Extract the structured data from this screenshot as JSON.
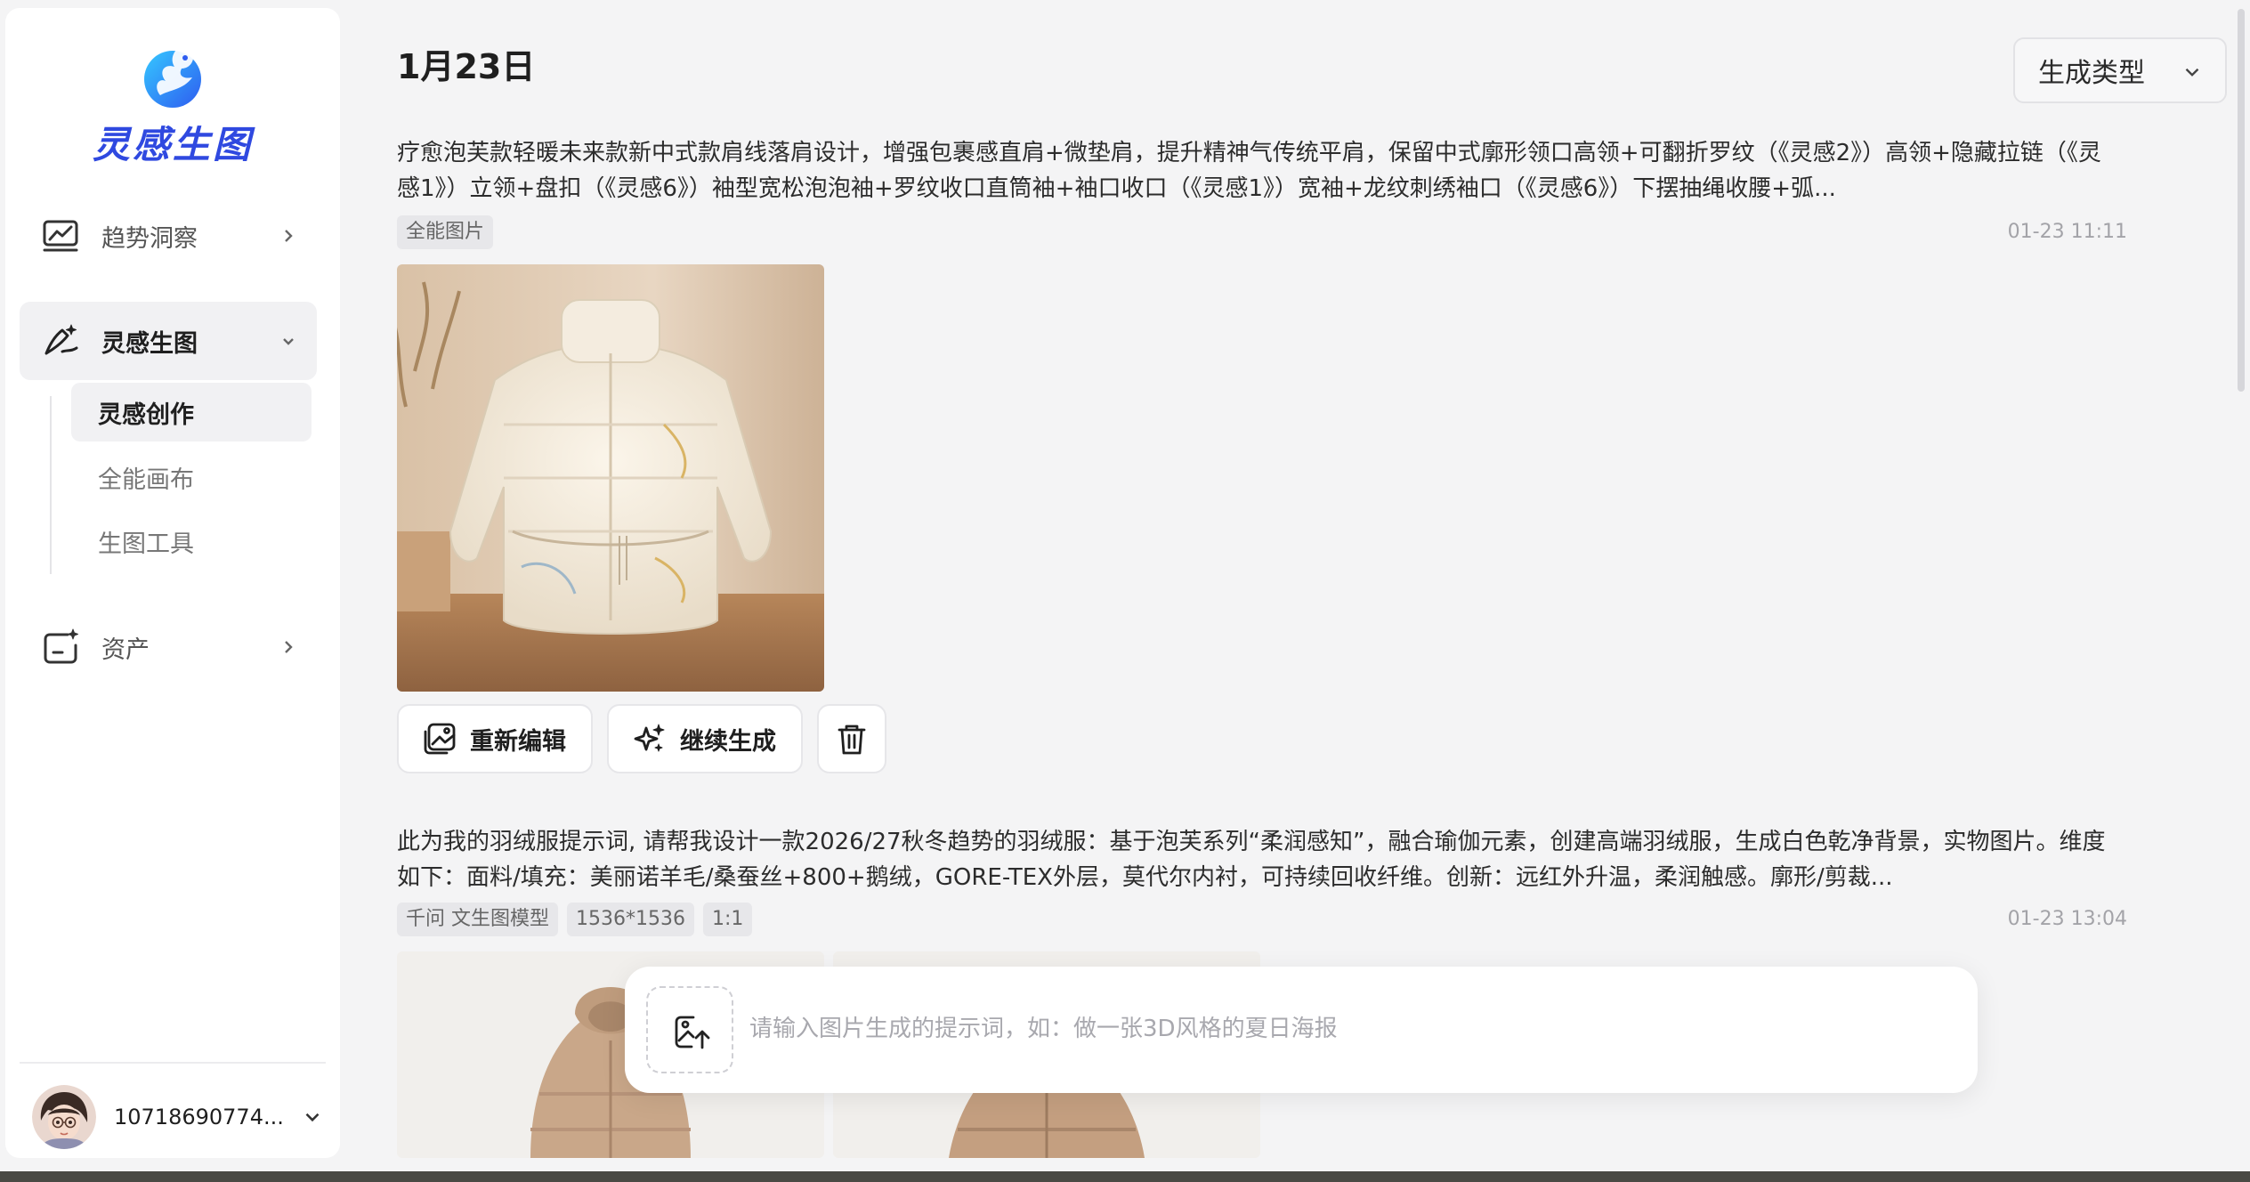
{
  "app": {
    "logo_text": "灵感生图"
  },
  "sidebar": {
    "nav": [
      {
        "label": "趋势洞察",
        "icon": "trend-chart-icon"
      },
      {
        "label": "灵感生图",
        "icon": "magic-pen-icon",
        "expanded": true
      },
      {
        "label": "资产",
        "icon": "asset-folder-icon"
      }
    ],
    "subnav": [
      {
        "label": "灵感创作",
        "active": true
      },
      {
        "label": "全能画布",
        "active": false
      },
      {
        "label": "生图工具",
        "active": false
      }
    ],
    "user": {
      "name": "10718690774..."
    }
  },
  "main": {
    "date": "1月23日",
    "type_filter": "生成类型",
    "records": [
      {
        "prompt": "疗愈泡芙款轻暖未来款新中式款肩线落肩设计，增强包裹感直肩+微垫肩，提升精神气传统平肩，保留中式廓形领口高领+可翻折罗纹（《灵感2》）高领+隐藏拉链（《灵感1》）立领+盘扣（《灵感6》）袖型宽松泡泡袖+罗纹收口直筒袖+袖口收口（《灵感1》）宽袖+龙纹刺绣袖口（《灵感6》）下摆抽绳收腰+弧...",
        "tags": [
          "全能图片"
        ],
        "time": "01-23 11:11"
      },
      {
        "prompt": "此为我的羽绒服提示词, 请帮我设计一款2026/27秋冬趋势的羽绒服：基于泡芙系列“柔润感知”，融合瑜伽元素，创建高端羽绒服，生成白色乾净背景，实物图片。维度如下：面料/填充：美丽诺羊毛/桑蚕丝+800+鹅绒，GORE-TEX外层，莫代尔内衬，可持续回收纤维。创新：远红外升温，柔润触感。廓形/剪裁...",
        "tags": [
          "千问 文生图模型",
          "1536*1536",
          "1:1"
        ],
        "time": "01-23 13:04"
      }
    ],
    "actions": {
      "reedit": "重新编辑",
      "continue": "继续生成"
    }
  },
  "input": {
    "placeholder": "请输入图片生成的提示词，如：做一张3D风格的夏日海报"
  }
}
